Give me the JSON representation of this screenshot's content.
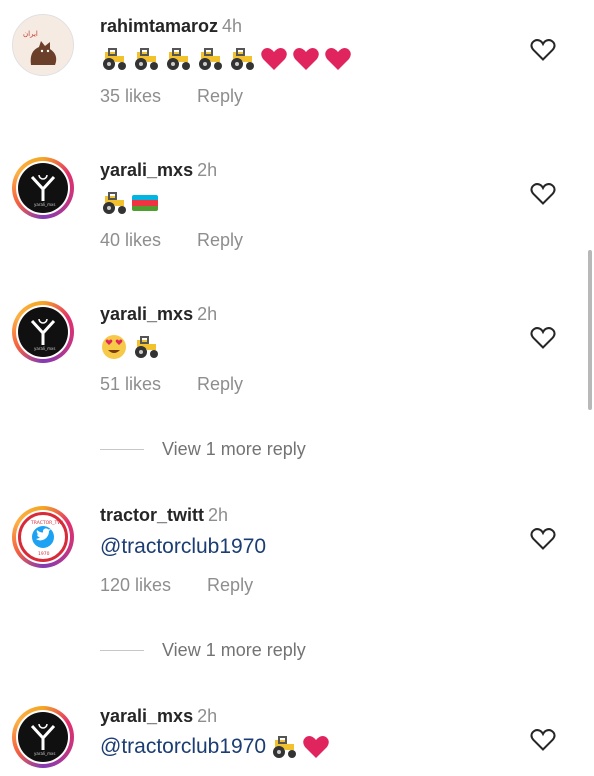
{
  "colors": {
    "username": "#262626",
    "meta": "#8e8e8e",
    "mention": "#1c3d73",
    "heart_red": "#e0245e"
  },
  "comments": [
    {
      "username": "rahimtamaroz",
      "time": "4h",
      "emojis": [
        "tractor",
        "tractor",
        "tractor",
        "tractor",
        "tractor",
        "red-heart",
        "red-heart",
        "red-heart"
      ],
      "likes": "35 likes",
      "reply": "Reply",
      "avatar_icon": "cat-avatar-icon",
      "avatar_text": "ایران"
    },
    {
      "username": "yarali_mxs",
      "time": "2h",
      "emojis": [
        "tractor",
        "azerbaijan-flag"
      ],
      "likes": "40 likes",
      "reply": "Reply",
      "avatar_icon": "yarali-logo-icon"
    },
    {
      "username": "yarali_mxs",
      "time": "2h",
      "emojis": [
        "heart-eyes-face",
        "tractor"
      ],
      "likes": "51 likes",
      "reply": "Reply",
      "avatar_icon": "yarali-logo-icon"
    },
    {
      "username": "tractor_twitt",
      "time": "2h",
      "text": "@tractorclub1970",
      "likes": "120 likes",
      "reply": "Reply",
      "avatar_icon": "tractor-twitt-logo-icon"
    },
    {
      "username": "yarali_mxs",
      "time": "2h",
      "text": "@tractorclub1970",
      "emojis": [
        "tractor",
        "red-heart"
      ],
      "avatar_icon": "yarali-logo-icon"
    }
  ],
  "view_more_1": "View 1 more reply",
  "view_more_2": "View 1 more reply"
}
